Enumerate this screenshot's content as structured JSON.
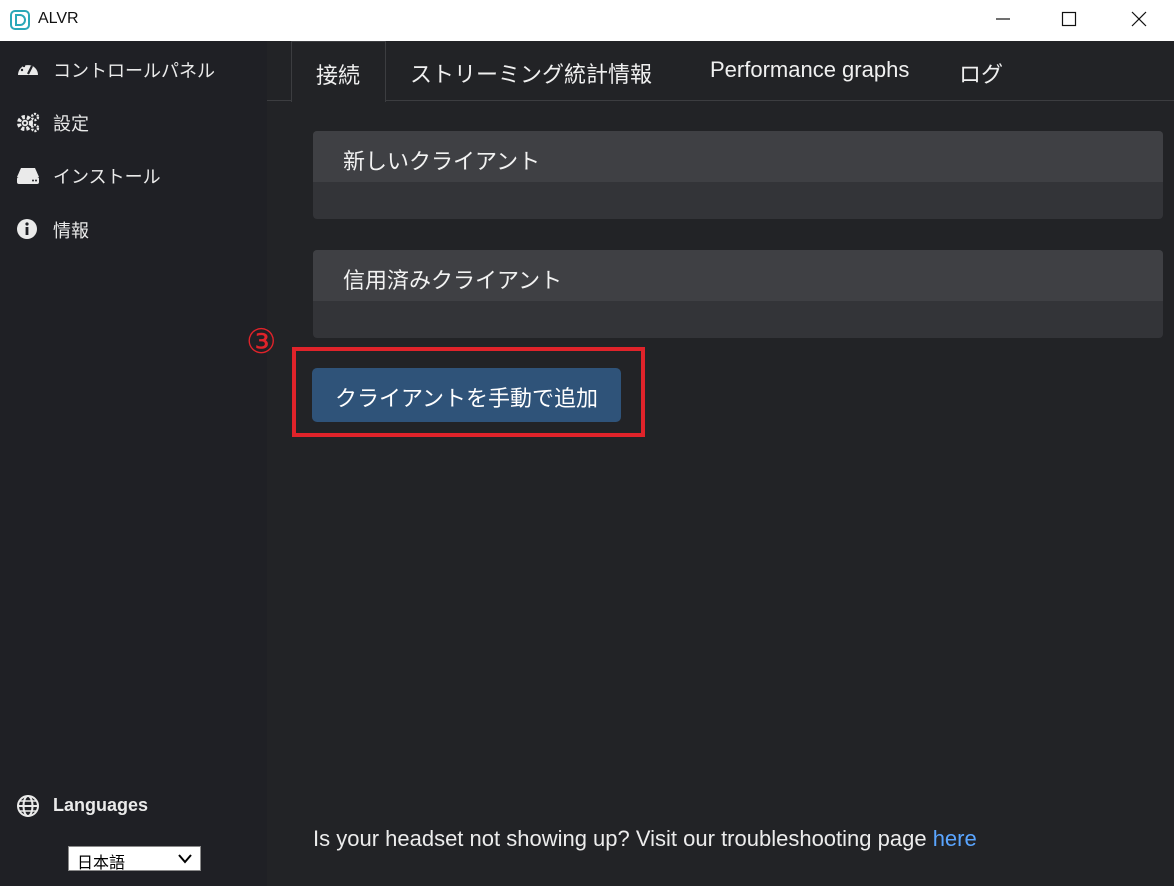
{
  "window": {
    "title": "ALVR",
    "controls": [
      "minimize-icon",
      "maximize-icon",
      "close-icon"
    ]
  },
  "sidebar": {
    "items": [
      {
        "label": "コントロールパネル",
        "icon": "dashboard-icon"
      },
      {
        "label": "設定",
        "icon": "gears-icon"
      },
      {
        "label": "インストール",
        "icon": "drive-icon"
      },
      {
        "label": "情報",
        "icon": "info-icon"
      }
    ],
    "languages": {
      "label": "Languages",
      "icon": "globe-icon",
      "selected": "日本語"
    }
  },
  "tabs": [
    {
      "label": "接続",
      "active": true
    },
    {
      "label": "ストリーミング統計情報",
      "active": false
    },
    {
      "label": "Performance graphs",
      "active": false
    },
    {
      "label": "ログ",
      "active": false
    }
  ],
  "connection": {
    "new_clients_title": "新しいクライアント",
    "trusted_clients_title": "信用済みクライアント",
    "add_client_button": "クライアントを手動で追加",
    "step_marker": "③",
    "footer_text": "Is your headset not showing up? Visit our troubleshooting page ",
    "footer_link": "here"
  },
  "colors": {
    "accent_button": "#2f5379",
    "annotation": "#e0232a",
    "link": "#5aa5ff"
  }
}
